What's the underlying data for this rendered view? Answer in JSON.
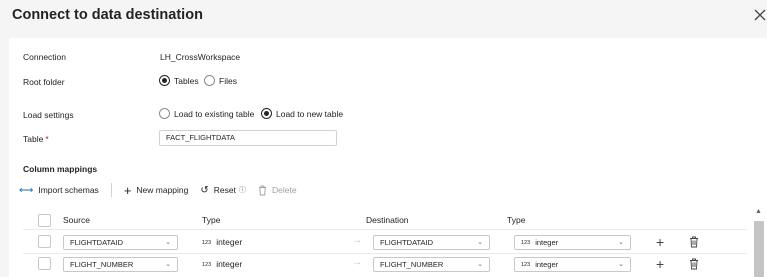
{
  "dialog": {
    "title": "Connect to data destination"
  },
  "connection": {
    "label": "Connection",
    "value": "LH_CrossWorkspace"
  },
  "root_folder": {
    "label": "Root folder",
    "options": [
      {
        "label": "Tables",
        "selected": true
      },
      {
        "label": "Files",
        "selected": false
      }
    ]
  },
  "load_settings": {
    "label": "Load settings",
    "options": [
      {
        "label": "Load to existing table",
        "selected": false
      },
      {
        "label": "Load to new table",
        "selected": true
      }
    ]
  },
  "table": {
    "label": "Table",
    "required_mark": "*",
    "value": "FACT_FLIGHTDATA"
  },
  "column_mappings": {
    "label": "Column mappings",
    "toolbar": {
      "import_schemas": "Import schemas",
      "new_mapping": "New mapping",
      "reset": "Reset",
      "delete": "Delete"
    },
    "headers": {
      "source": "Source",
      "type": "Type",
      "destination": "Destination",
      "dest_type": "Type"
    },
    "rows": [
      {
        "source": "FLIGHTDATAID",
        "type_prefix": "123",
        "type": "integer",
        "destination": "FLIGHTDATAID",
        "dest_type_prefix": "123",
        "dest_type": "integer"
      },
      {
        "source": "FLIGHT_NUMBER",
        "type_prefix": "123",
        "type": "integer",
        "destination": "FLIGHT_NUMBER",
        "dest_type_prefix": "123",
        "dest_type": "integer"
      }
    ]
  },
  "icons": {
    "arrow_right": "→",
    "chevron": "⌄",
    "plus": "+",
    "info": "ⓘ",
    "import": "⟷",
    "reset": "↺"
  }
}
